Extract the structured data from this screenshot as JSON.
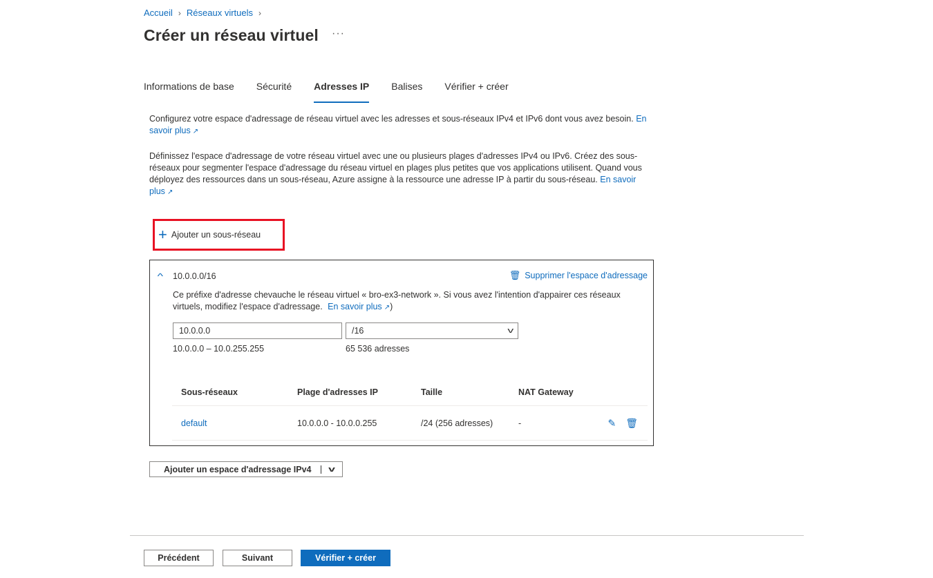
{
  "breadcrumb": {
    "items": [
      "Accueil",
      "Réseaux virtuels"
    ]
  },
  "page": {
    "title": "Créer un réseau virtuel",
    "more": "···"
  },
  "tabs": [
    "Informations de base",
    "Sécurité",
    "Adresses IP",
    "Balises",
    "Vérifier + créer"
  ],
  "intro": {
    "p1": "Configurez votre espace d'adressage de réseau virtuel avec les adresses et sous-réseaux IPv4 et IPv6 dont vous avez besoin.",
    "p1_link": "En savoir plus",
    "p2": "Définissez l'espace d'adressage de votre réseau virtuel avec une ou plusieurs plages d'adresses IPv4 ou IPv6. Créez des sous-réseaux pour segmenter l'espace d'adressage du réseau virtuel en plages plus petites que vos applications utilisent. Quand vous déployez des ressources dans un sous-réseau, Azure assigne à la ressource une adresse IP à partir du sous-réseau.",
    "p2_link": "En savoir plus"
  },
  "add_subnet": {
    "label": "Ajouter un sous-réseau"
  },
  "address_space": {
    "label": "10.0.0.0/16",
    "delete_label": "Supprimer l'espace d'adressage",
    "warning": "Ce préfixe d'adresse chevauche le réseau virtuel « bro-ex3-network ». Si vous avez l'intention d'appairer ces réseaux virtuels, modifiez l'espace d'adressage.",
    "warning_link": "En savoir plus",
    "ip_value": "10.0.0.0",
    "prefix_value": "/16",
    "range": "10.0.0.0 – 10.0.255.255",
    "count": "65 536 adresses"
  },
  "subnet_table": {
    "headers": [
      "Sous-réseaux",
      "Plage d'adresses IP",
      "Taille",
      "NAT Gateway"
    ],
    "rows": [
      {
        "name": "default",
        "range": "10.0.0.0 - 10.0.0.255",
        "size": "/24 (256 adresses)",
        "nat": "-"
      }
    ]
  },
  "add_ipv4": {
    "label": "Ajouter un espace d'adressage IPv4"
  },
  "footer": {
    "prev": "Précédent",
    "next": "Suivant",
    "review": "Vérifier + créer"
  },
  "colors": {
    "accent": "#0f6cbd",
    "highlight": "#e81123"
  }
}
